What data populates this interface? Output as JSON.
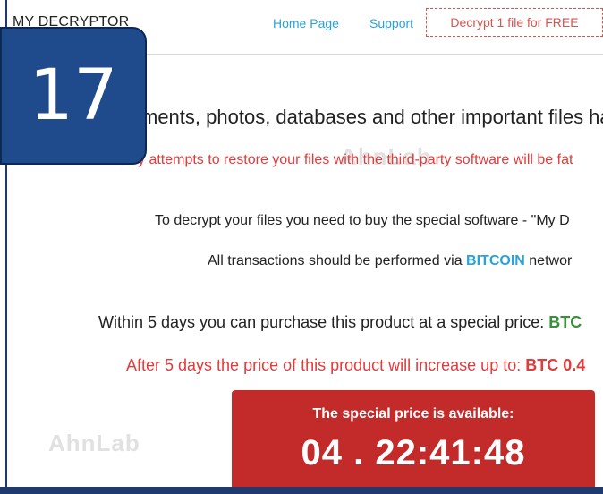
{
  "header": {
    "brand": "MY DECRYPTOR",
    "nav": [
      "Home Page",
      "Support"
    ],
    "free_button": "Decrypt 1 file for FREE"
  },
  "badge": {
    "number": "17"
  },
  "content": {
    "headline": "ments, photos, databases and other important files ha",
    "warning": "y attempts to restore your files with the third-party software will be fat",
    "decrypt_line": "To decrypt your files you need to buy the special software - \"My D",
    "btc_line_prefix": "All transactions should be performed via ",
    "btc_word": "BITCOIN",
    "btc_line_suffix": " networ",
    "within_prefix": "Within 5 days you can purchase this product at a special price: ",
    "within_price": "BTC",
    "after_prefix": "After 5 days the price of this product will increase up to: ",
    "after_price": "BTC 0.4"
  },
  "timer": {
    "label": "The special price is available:",
    "value": "04 . 22:41:48"
  },
  "watermark": "AhnLab",
  "colors": {
    "accent_blue": "#29a3d8",
    "warning_red": "#e03c3c",
    "timer_bg": "#c32a2a",
    "badge_bg": "#1f4a8c"
  }
}
